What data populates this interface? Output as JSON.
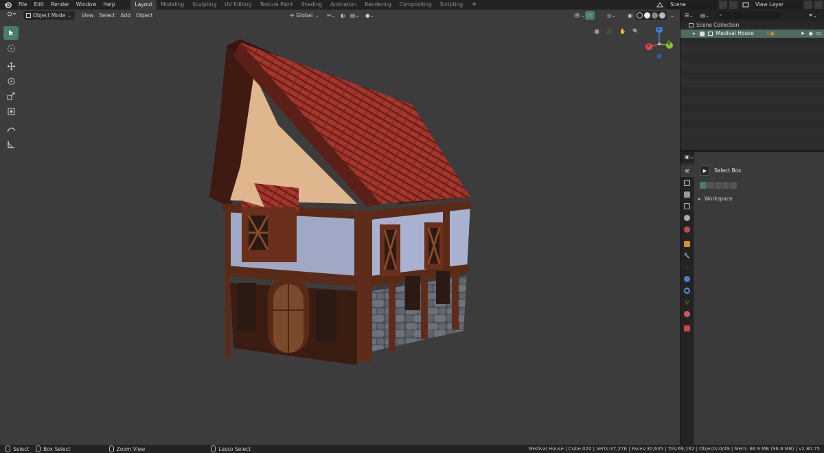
{
  "menu": [
    "File",
    "Edit",
    "Render",
    "Window",
    "Help"
  ],
  "workspaces": [
    "Layout",
    "Modeling",
    "Sculpting",
    "UV Editing",
    "Texture Paint",
    "Shading",
    "Animation",
    "Rendering",
    "Compositing",
    "Scripting"
  ],
  "active_workspace": "Layout",
  "scene_name": "Scene",
  "view_layer_name": "View Layer",
  "viewport": {
    "mode": "Object Mode",
    "menus": [
      "View",
      "Select",
      "Add",
      "Object"
    ],
    "transform_orientation": "Global"
  },
  "gizmo": {
    "x_label": "X",
    "y_label": "Y",
    "z_label": "Z"
  },
  "outliner": {
    "scene_collection": "Scene Collection",
    "object": "Medival House"
  },
  "properties": {
    "active_tool": "Select Box",
    "workspace_panel": "Workspace"
  },
  "statusbar": {
    "select": "Select",
    "box_select": "Box Select",
    "zoom_view": "Zoom View",
    "lasso_select": "Lasso Select",
    "stats": "Medival House | Cube.020 | Verts:37,276 | Faces:30,635 | Tris:69,162 | Objects:0/49 | Mem: 66.9 MB (96.8 MB) | v2.80.75"
  },
  "colors": {
    "accent": "#4a7c6c",
    "selection_row": "#4f6b5d",
    "axis_x": "#e34a4a",
    "axis_y": "#8ac926",
    "axis_z": "#3f7fe0"
  }
}
